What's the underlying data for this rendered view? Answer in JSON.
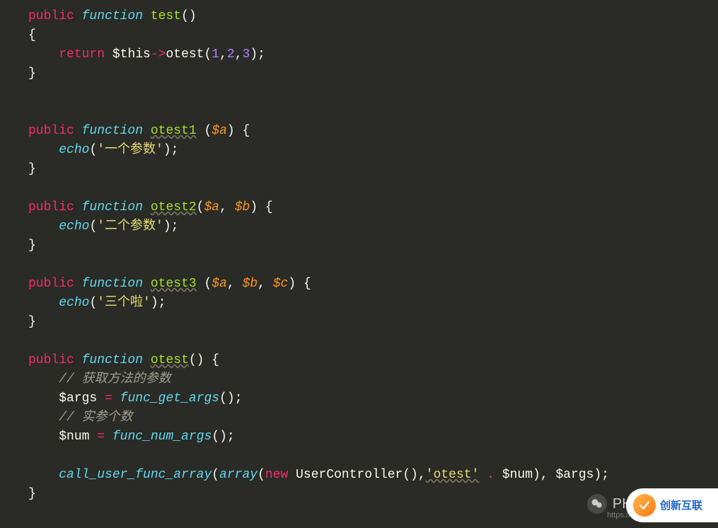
{
  "func_test": {
    "mod": "public",
    "kw": "function",
    "name": "test",
    "ret": "return",
    "this": "$this",
    "method": "otest",
    "args": [
      "1",
      "2",
      "3"
    ]
  },
  "func_otest1": {
    "mod": "public",
    "kw": "function",
    "name": "otest1",
    "params": [
      "$a"
    ],
    "echo": "echo",
    "str": "'一个参数'"
  },
  "func_otest2": {
    "mod": "public",
    "kw": "function",
    "name": "otest2",
    "params": [
      "$a",
      "$b"
    ],
    "echo": "echo",
    "str": "'二个参数'"
  },
  "func_otest3": {
    "mod": "public",
    "kw": "function",
    "name": "otest3",
    "params": [
      "$a",
      "$b",
      "$c"
    ],
    "echo": "echo",
    "str": "'三个啦'"
  },
  "func_otest": {
    "mod": "public",
    "kw": "function",
    "name": "otest",
    "comment1": "// 获取方法的参数",
    "var_args": "$args",
    "fn_get_args": "func_get_args",
    "comment2": "// 实参个数",
    "var_num": "$num",
    "fn_num_args": "func_num_args",
    "call_fn": "call_user_func_array",
    "array_kw": "array",
    "new_kw": "new",
    "class": "UserController",
    "str_otest": "'otest'",
    "concat_var": "$num",
    "last_arg": "$args"
  },
  "watermark": {
    "wechat_label": "PHP初",
    "blog": "https://blog."
  },
  "corner": {
    "text": "创新互联"
  }
}
